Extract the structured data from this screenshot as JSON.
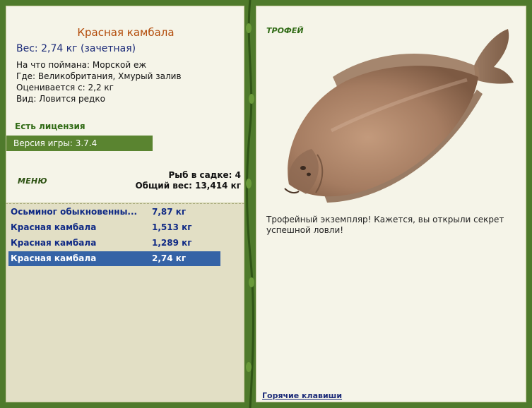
{
  "fish": {
    "name": "Красная камбала",
    "weight_line": "Вес: 2,74 кг (зачетная)",
    "bait": "На что поймана: Морской еж",
    "location": "Где: Великобритания, Хмурый залив",
    "valued_from": "Оценивается с: 2,2 кг",
    "rarity": "Вид: Ловится редко"
  },
  "license": "Есть лицензия",
  "version": "Версия игры: 3.7.4",
  "menu_label": "МЕНЮ",
  "stats": {
    "count": "Рыб в садке: 4",
    "total": "Общий вес: 13,414 кг"
  },
  "catch_list": [
    {
      "name": "Осьминог обыкновенны...",
      "weight": "7,87 кг",
      "selected": false
    },
    {
      "name": "Красная камбала",
      "weight": "1,513 кг",
      "selected": false
    },
    {
      "name": "Красная камбала",
      "weight": "1,289 кг",
      "selected": false
    },
    {
      "name": "Красная камбала",
      "weight": "2,74 кг",
      "selected": true
    }
  ],
  "trophy": {
    "label": "ТРОФЕЙ",
    "text": "Трофейный экземпляр! Кажется, вы открыли секрет успешной ловли!"
  },
  "hotkeys": "Горячие клавиши",
  "colors": {
    "frame_green": "#4f7a2c",
    "panel_bg": "#f5f4e8",
    "title_orange": "#b24a08",
    "link_blue": "#1b2a78",
    "selection_blue": "#3563a6"
  }
}
